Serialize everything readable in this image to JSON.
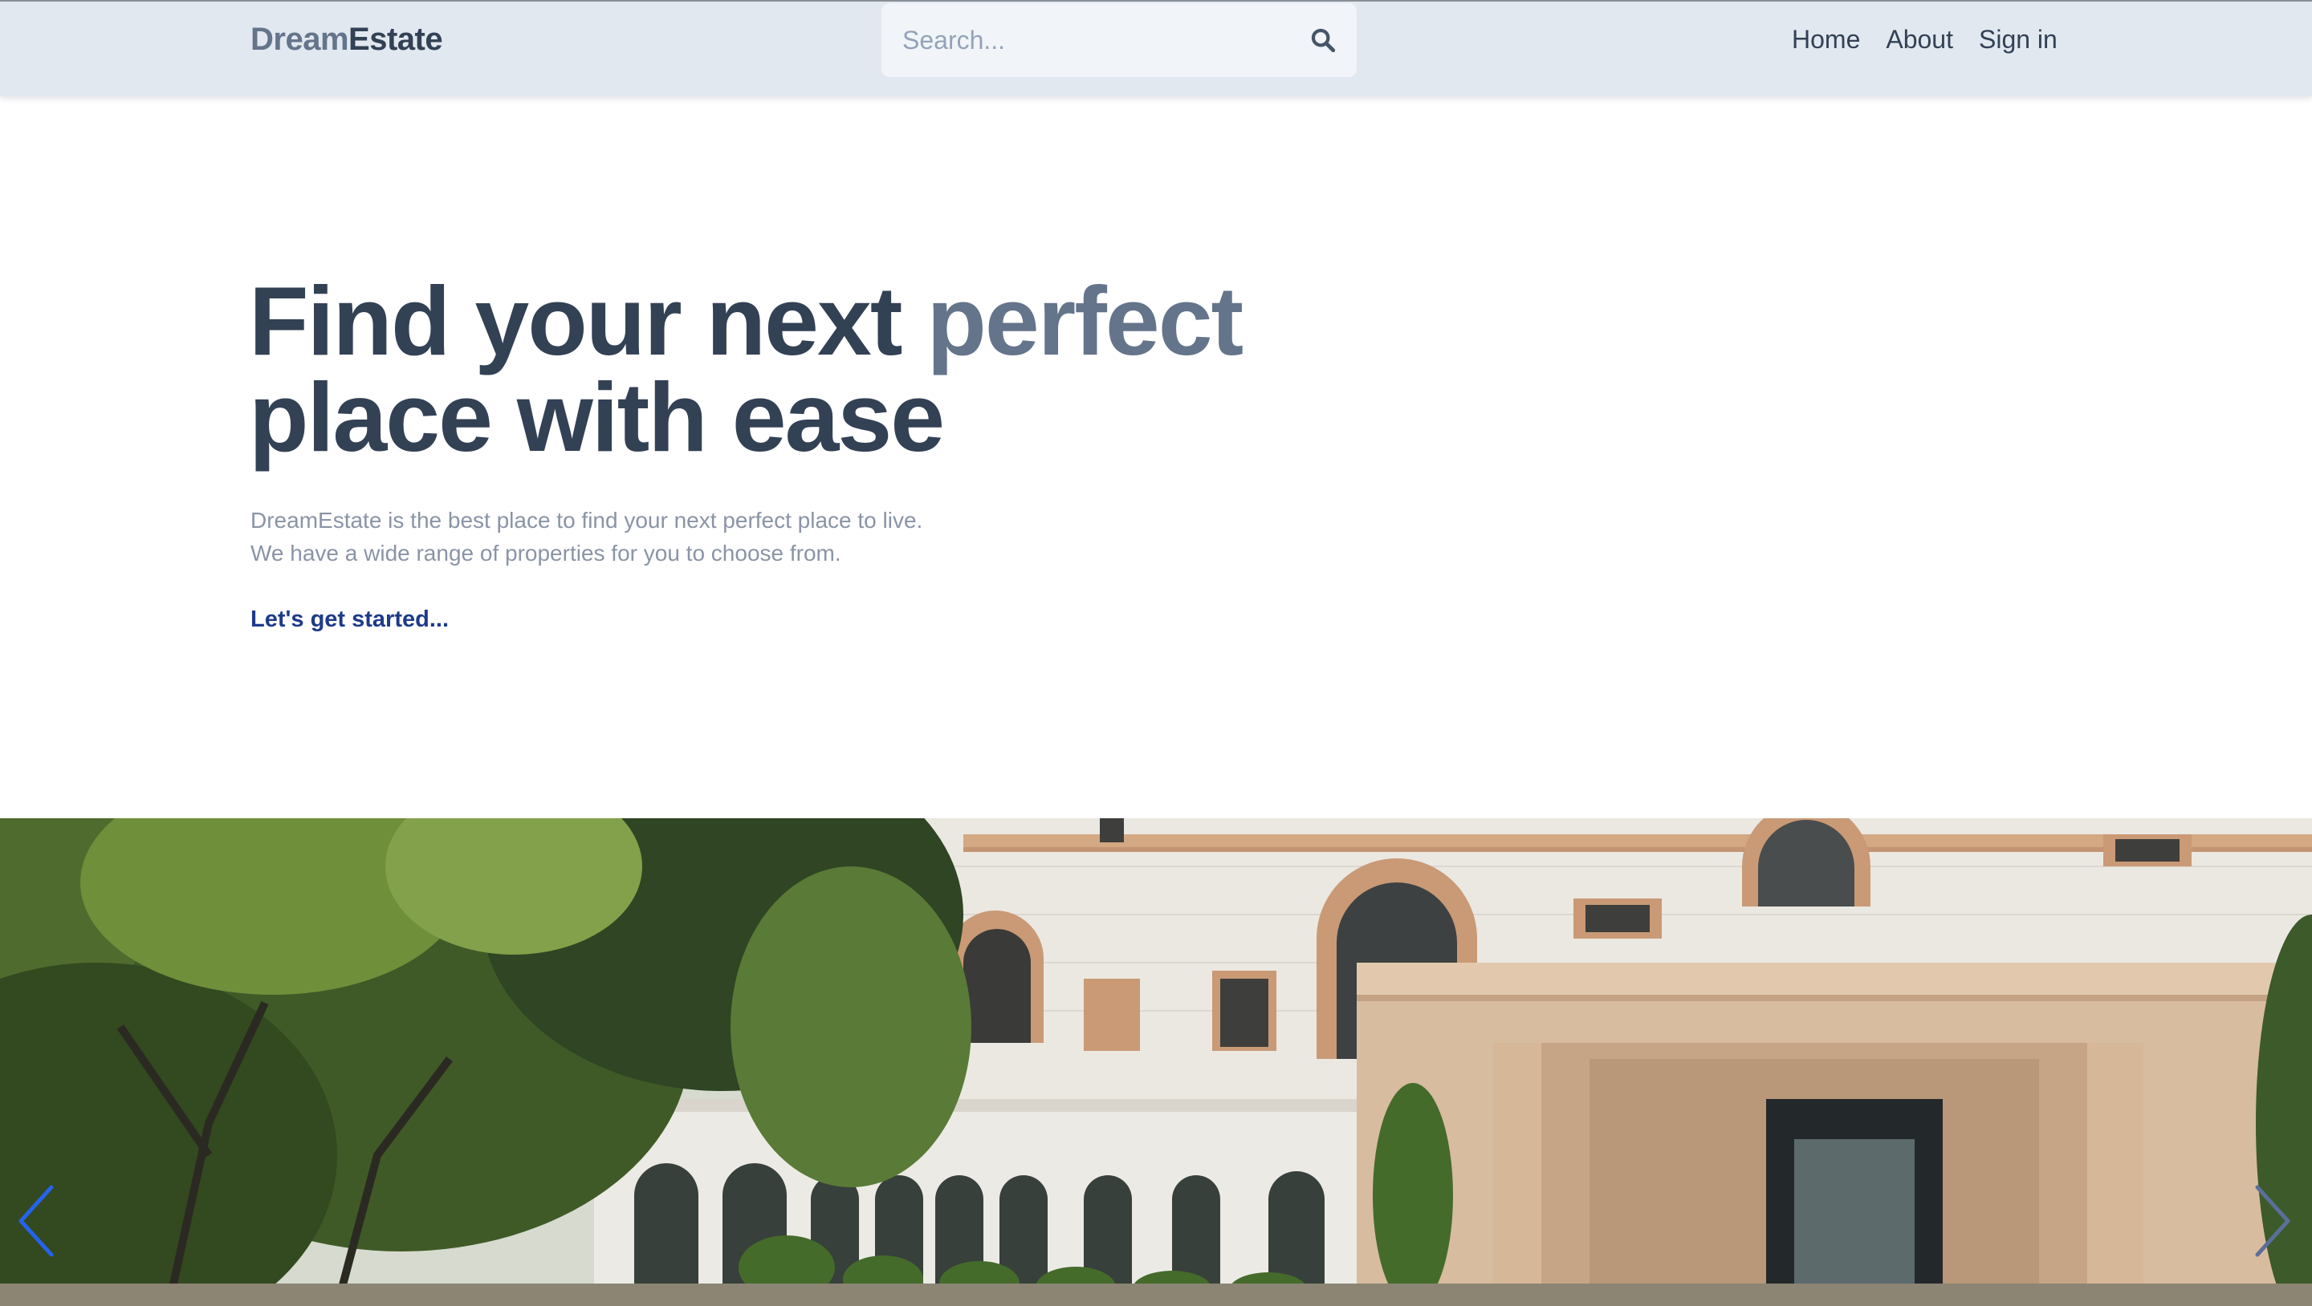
{
  "brand": {
    "part1": "Dream",
    "part2": "Estate"
  },
  "search": {
    "placeholder": "Search...",
    "icon": "search-icon"
  },
  "nav": {
    "items": [
      {
        "label": "Home"
      },
      {
        "label": "About"
      },
      {
        "label": "Sign in"
      }
    ]
  },
  "hero": {
    "title_part1": "Find your next ",
    "title_accent": "perfect",
    "title_part2": "place with ease",
    "description_line1": "DreamEstate is the best place to find your next perfect place to live.",
    "description_line2": "We have a wide range of properties for you to choose from.",
    "cta_label": "Let's get started..."
  },
  "carousel": {
    "prev_icon": "chevron-left-icon",
    "next_icon": "chevron-right-icon"
  },
  "colors": {
    "header_bg": "#e2e8f0",
    "brand_light": "#64748b",
    "brand_dark": "#334155",
    "cta": "#1e3a8a",
    "arrow": "#2563eb"
  }
}
